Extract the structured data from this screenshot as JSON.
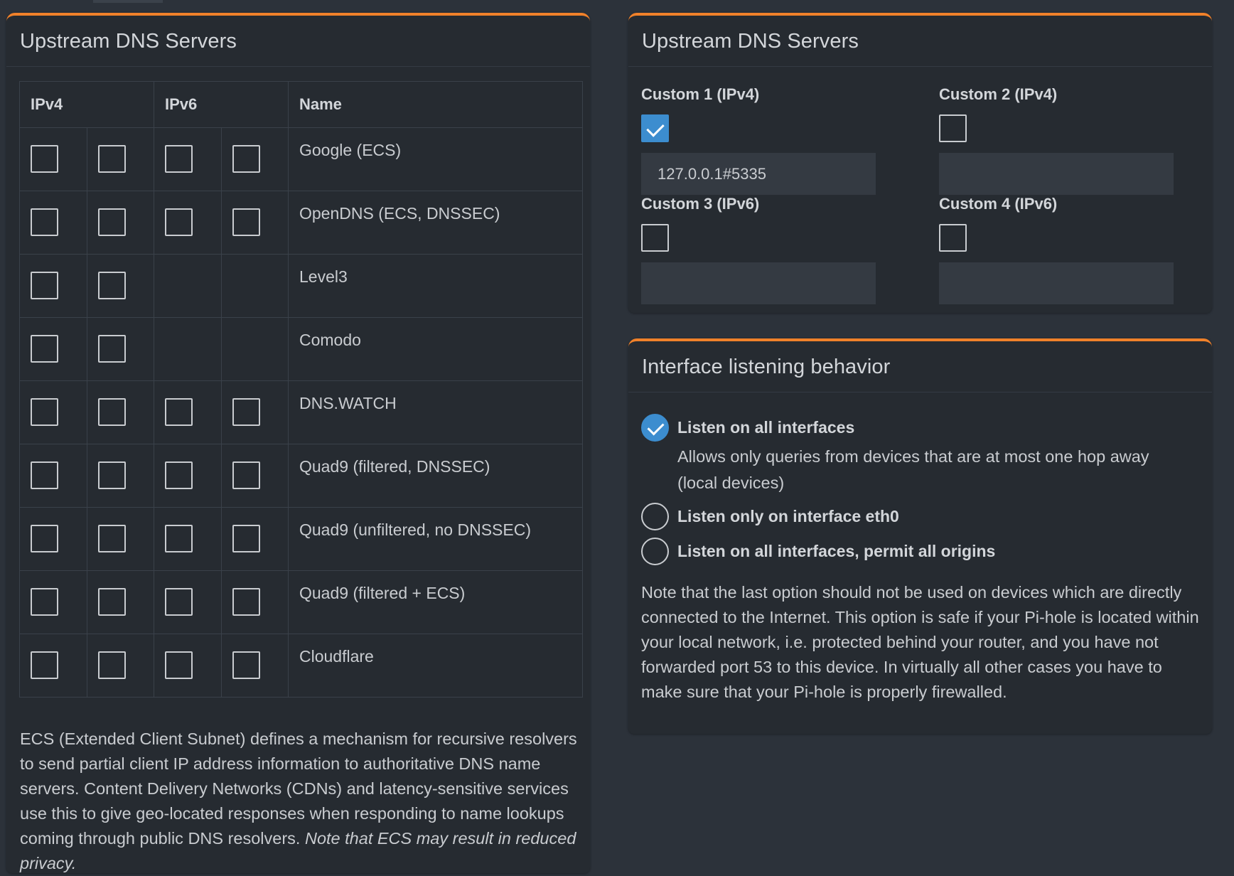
{
  "left_panel": {
    "title": "Upstream DNS Servers",
    "columns": {
      "ipv4": "IPv4",
      "ipv6": "IPv6",
      "name": "Name"
    },
    "rows": [
      {
        "name": "Google (ECS)",
        "ipv4": [
          false,
          false
        ],
        "ipv6": [
          false,
          false
        ],
        "has_ipv6": true
      },
      {
        "name": "OpenDNS (ECS, DNSSEC)",
        "ipv4": [
          false,
          false
        ],
        "ipv6": [
          false,
          false
        ],
        "has_ipv6": true
      },
      {
        "name": "Level3",
        "ipv4": [
          false,
          false
        ],
        "ipv6": [],
        "has_ipv6": false
      },
      {
        "name": "Comodo",
        "ipv4": [
          false,
          false
        ],
        "ipv6": [],
        "has_ipv6": false
      },
      {
        "name": "DNS.WATCH",
        "ipv4": [
          false,
          false
        ],
        "ipv6": [
          false,
          false
        ],
        "has_ipv6": true
      },
      {
        "name": "Quad9 (filtered, DNSSEC)",
        "ipv4": [
          false,
          false
        ],
        "ipv6": [
          false,
          false
        ],
        "has_ipv6": true
      },
      {
        "name": "Quad9 (unfiltered, no DNSSEC)",
        "ipv4": [
          false,
          false
        ],
        "ipv6": [
          false,
          false
        ],
        "has_ipv6": true
      },
      {
        "name": "Quad9 (filtered + ECS)",
        "ipv4": [
          false,
          false
        ],
        "ipv6": [
          false,
          false
        ],
        "has_ipv6": true
      },
      {
        "name": "Cloudflare",
        "ipv4": [
          false,
          false
        ],
        "ipv6": [
          false,
          false
        ],
        "has_ipv6": true
      }
    ],
    "ecs_note": "ECS (Extended Client Subnet) defines a mechanism for recursive resolvers to send partial client IP address information to authoritative DNS name servers. Content Delivery Networks (CDNs) and latency-sensitive services use this to give geo-located responses when responding to name lookups coming through public DNS resolvers.",
    "ecs_note_italic": "Note that ECS may result in reduced privacy."
  },
  "custom_panel": {
    "title": "Upstream DNS Servers",
    "items": [
      {
        "label": "Custom 1 (IPv4)",
        "checked": true,
        "value": "127.0.0.1#5335"
      },
      {
        "label": "Custom 2 (IPv4)",
        "checked": false,
        "value": ""
      },
      {
        "label": "Custom 3 (IPv6)",
        "checked": false,
        "value": ""
      },
      {
        "label": "Custom 4 (IPv6)",
        "checked": false,
        "value": ""
      }
    ]
  },
  "interface_panel": {
    "title": "Interface listening behavior",
    "options": [
      {
        "label": "Listen on all interfaces",
        "selected": true,
        "description": "Allows only queries from devices that are at most one hop away (local devices)"
      },
      {
        "label": "Listen only on interface eth0",
        "selected": false,
        "description": ""
      },
      {
        "label": "Listen on all interfaces, permit all origins",
        "selected": false,
        "description": ""
      }
    ],
    "note": "Note that the last option should not be used on devices which are directly connected to the Internet. This option is safe if your Pi-hole is located within your local network, i.e. protected behind your router, and you have not forwarded port 53 to this device. In virtually all other cases you have to make sure that your Pi-hole is properly firewalled."
  },
  "colors": {
    "accent_border": "#f0812a",
    "checked_blue": "#3c8dcf",
    "panel_bg": "#262b31",
    "page_bg": "#2c323a"
  }
}
